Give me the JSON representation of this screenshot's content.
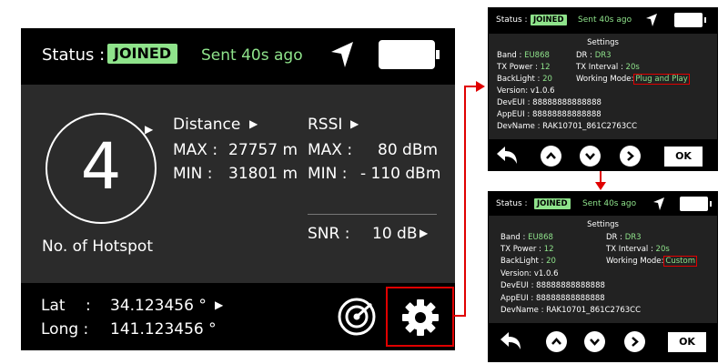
{
  "main": {
    "status_label": "Status :",
    "status_badge": "JOINED",
    "sent": "Sent 40s ago",
    "hotspot_count": "4",
    "hotspot_label": "No. of Hotspot",
    "distance": {
      "label": "Distance",
      "max_label": "MAX :",
      "max_value": "27757 m",
      "min_label": "MIN :",
      "min_value": "31801 m"
    },
    "rssi": {
      "label": "RSSI",
      "max_label": "MAX :",
      "max_value": "80 dBm",
      "min_label": "MIN :",
      "min_value": "- 110 dBm"
    },
    "snr": {
      "label": "SNR :",
      "value": "10 dB"
    },
    "lat": {
      "label": "Lat",
      "sep": ":",
      "value": "34.123456 °"
    },
    "long": {
      "label": "Long :",
      "value": "141.123456 °"
    }
  },
  "screen_a": {
    "status_label": "Status :",
    "status_badge": "JOINED",
    "sent": "Sent 40s ago",
    "settings_title": "Settings",
    "band_label": "Band :",
    "band_value": "EU868",
    "dr_label": "DR :",
    "dr_value": "DR3",
    "tx_power_label": "TX Power :",
    "tx_power_value": "12",
    "tx_interval_label": "TX Interval :",
    "tx_interval_value": "20s",
    "backlight_label": "BackLight :",
    "backlight_value": "20",
    "mode_label": "Working Mode:",
    "mode_value": "Plug and Play",
    "version": "Version: v1.0.6",
    "deveui": "DevEUI : 88888888888888",
    "appeui": "AppEUI : 88888888888888",
    "devname": "DevName : RAK10701_861C2763CC",
    "ok_label": "OK"
  },
  "screen_b": {
    "status_label": "Status :",
    "status_badge": "JOINED",
    "sent": "Sent 40s ago",
    "settings_title": "Settings",
    "band_label": "Band :",
    "band_value": "EU868",
    "dr_label": "DR :",
    "dr_value": "DR3",
    "tx_power_label": "TX Power :",
    "tx_power_value": "12",
    "tx_interval_label": "TX Interval :",
    "tx_interval_value": "20s",
    "backlight_label": "BackLight :",
    "backlight_value": "20",
    "mode_label": "Working Mode:",
    "mode_value": "Custom",
    "version": "Version: v1.0.6",
    "deveui": "DevEUI : 88888888888888",
    "appeui": "AppEUI : 88888888888888",
    "devname": "DevName : RAK10701_861C2763CC",
    "ok_label": "OK"
  },
  "colors": {
    "accent_green": "#8fe38b",
    "highlight_red": "#e00000",
    "panel_gray": "#2b2b2b"
  },
  "icons": [
    "navigation-arrow-icon",
    "battery-icon",
    "play-icon",
    "radar-icon",
    "gear-icon",
    "back-arrow-icon",
    "chevron-up-icon",
    "chevron-down-icon",
    "chevron-right-icon"
  ]
}
